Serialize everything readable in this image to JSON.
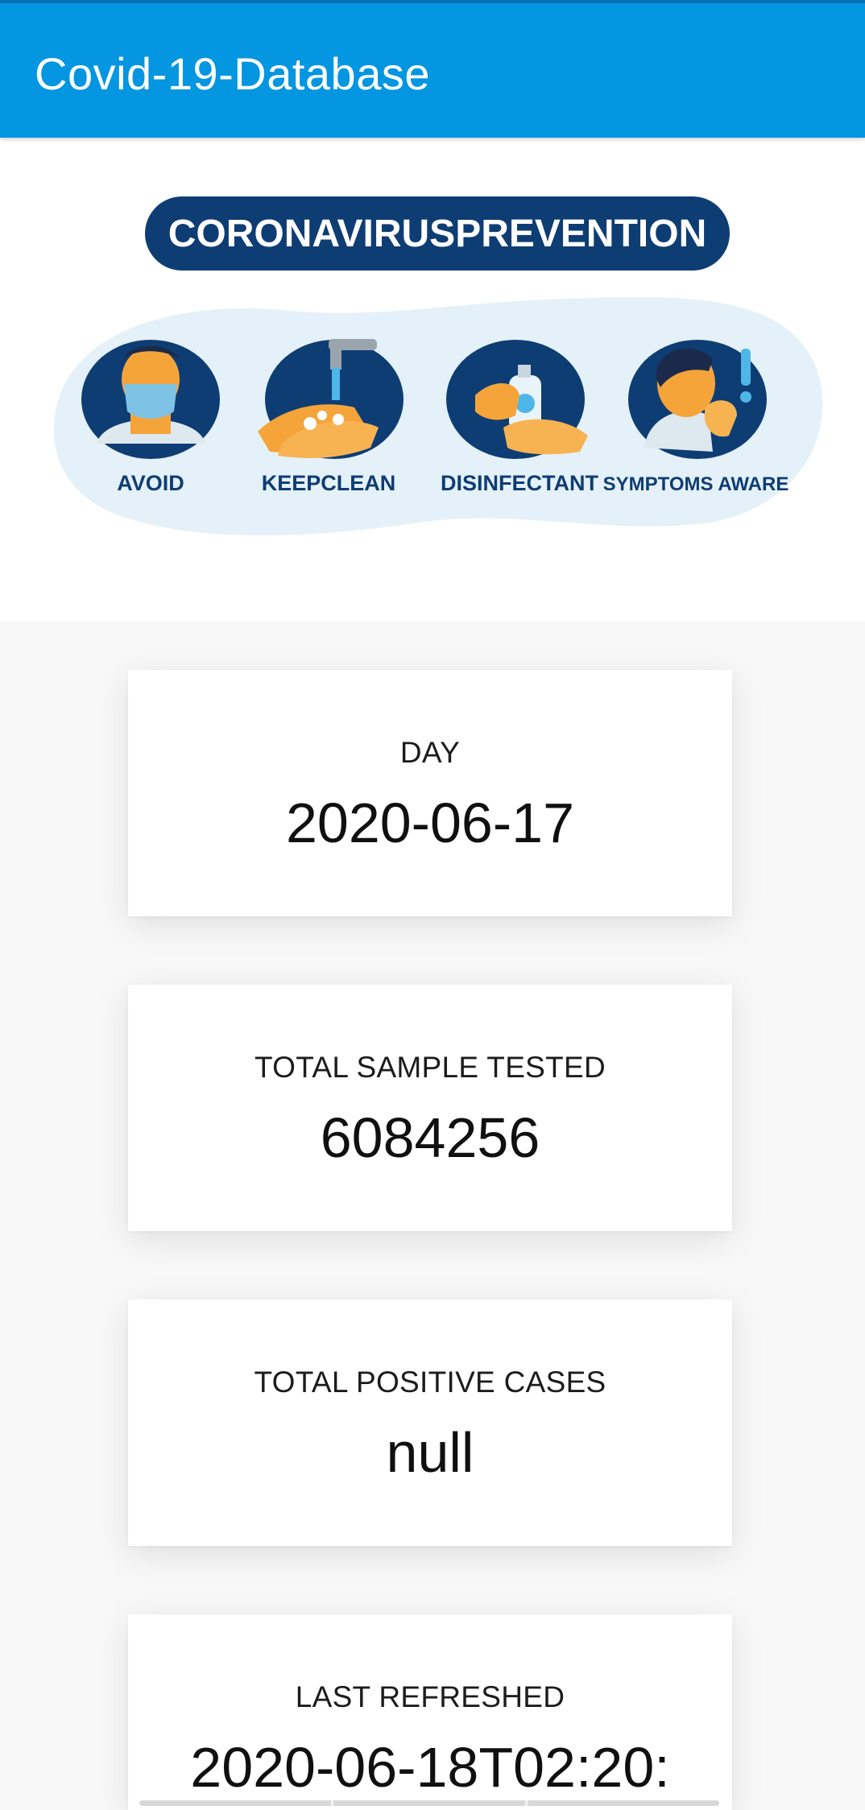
{
  "app_bar": {
    "title": "Covid-19-Database",
    "color": "#0496e0"
  },
  "banner": {
    "heading": "CORONAVIRUSPREVENTION",
    "items": [
      {
        "label": "AVOID",
        "icon": "person-mask-icon"
      },
      {
        "label": "KEEPCLEAN",
        "icon": "handwash-icon"
      },
      {
        "label": "DISINFECTANT",
        "icon": "sanitizer-icon"
      },
      {
        "label": "SYMPTOMS AWARE",
        "icon": "cough-icon"
      }
    ],
    "heading_color": "#0e3d74",
    "blob_color": "#e5f1f8"
  },
  "cards": {
    "day": {
      "label": "DAY",
      "value": "2020-06-17"
    },
    "tested": {
      "label": "TOTAL SAMPLE TESTED",
      "value": "6084256"
    },
    "positive": {
      "label": "TOTAL POSITIVE CASES",
      "value": "null"
    },
    "refreshed": {
      "label": "LAST REFRESHED",
      "value": "2020-06-18T02:20:"
    }
  }
}
